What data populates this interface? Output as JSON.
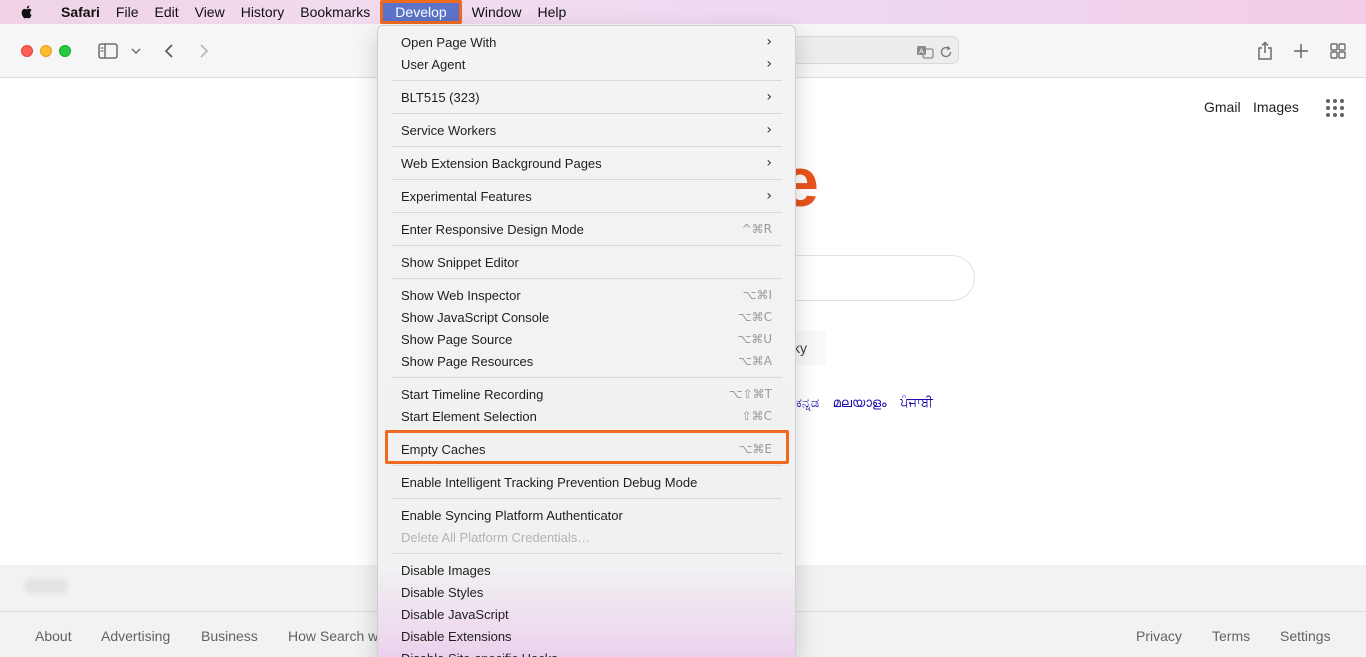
{
  "menubar": {
    "apple_icon": "apple-logo-icon",
    "items": [
      {
        "label": "Safari",
        "bold": true
      },
      {
        "label": "File"
      },
      {
        "label": "Edit"
      },
      {
        "label": "View"
      },
      {
        "label": "History"
      },
      {
        "label": "Bookmarks"
      },
      {
        "label": "Develop",
        "active": true
      },
      {
        "label": "Window"
      },
      {
        "label": "Help"
      }
    ]
  },
  "toolbar": {
    "icons": [
      "sidebar-icon",
      "chevron-down-icon",
      "back-icon",
      "forward-icon",
      "translate-icon",
      "reload-icon",
      "share-icon",
      "new-tab-icon",
      "tab-overview-icon"
    ]
  },
  "page": {
    "top_links": {
      "gmail": "Gmail",
      "images": "Images"
    },
    "lucky_fragment": "ky",
    "languages": [
      "ಕನ್ನಡ",
      "മലയാളം",
      "ਪੰਜਾਬੀ"
    ],
    "footer_left": [
      "About",
      "Advertising",
      "Business",
      "How Search w"
    ],
    "footer_right": [
      "Privacy",
      "Terms",
      "Settings"
    ]
  },
  "develop_menu": {
    "groups": [
      [
        {
          "label": "Open Page With",
          "submenu": true
        },
        {
          "label": "User Agent",
          "submenu": true
        }
      ],
      [
        {
          "label": "BLT515 (323)",
          "submenu": true
        }
      ],
      [
        {
          "label": "Service Workers",
          "submenu": true
        }
      ],
      [
        {
          "label": "Web Extension Background Pages",
          "submenu": true
        }
      ],
      [
        {
          "label": "Experimental Features",
          "submenu": true
        }
      ],
      [
        {
          "label": "Enter Responsive Design Mode",
          "shortcut": "^⌘R"
        }
      ],
      [
        {
          "label": "Show Snippet Editor"
        }
      ],
      [
        {
          "label": "Show Web Inspector",
          "shortcut": "⌥⌘I"
        },
        {
          "label": "Show JavaScript Console",
          "shortcut": "⌥⌘C"
        },
        {
          "label": "Show Page Source",
          "shortcut": "⌥⌘U"
        },
        {
          "label": "Show Page Resources",
          "shortcut": "⌥⌘A"
        }
      ],
      [
        {
          "label": "Start Timeline Recording",
          "shortcut": "⌥⇧⌘T"
        },
        {
          "label": "Start Element Selection",
          "shortcut": "⇧⌘C"
        }
      ],
      [
        {
          "label": "Empty Caches",
          "shortcut": "⌥⌘E",
          "highlighted": true
        }
      ],
      [
        {
          "label": "Enable Intelligent Tracking Prevention Debug Mode"
        }
      ],
      [
        {
          "label": "Enable Syncing Platform Authenticator"
        },
        {
          "label": "Delete All Platform Credentials…",
          "disabled": true
        }
      ],
      [
        {
          "label": "Disable Images"
        },
        {
          "label": "Disable Styles"
        },
        {
          "label": "Disable JavaScript"
        },
        {
          "label": "Disable Extensions"
        },
        {
          "label": "Disable Site-specific Hacks"
        }
      ]
    ]
  },
  "colors": {
    "highlight_border": "#ee6a1e",
    "active_menu_bg": "#5b73c9"
  }
}
